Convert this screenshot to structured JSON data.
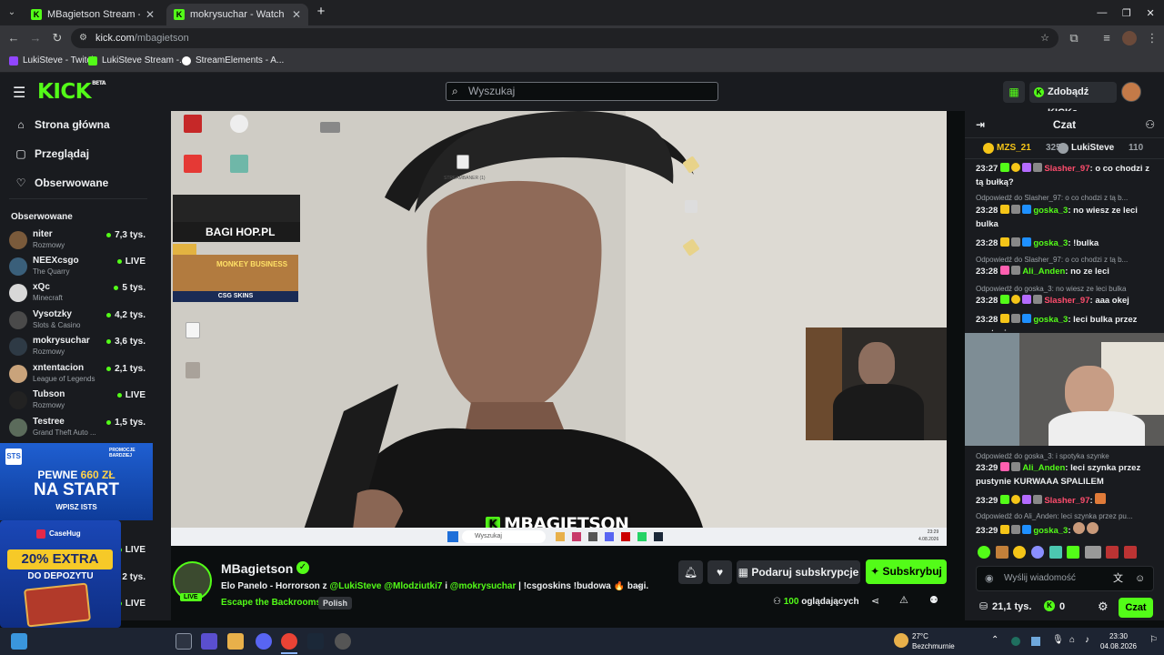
{
  "browser": {
    "tabs": [
      {
        "title": "MBagietson Stream - Watch Liv",
        "active": false
      },
      {
        "title": "mokrysuchar - Watch clips on K",
        "active": true
      }
    ],
    "new_tab": "+",
    "url_host": "kick.com",
    "url_path": "/mbagietson",
    "bookmarks": [
      {
        "label": "LukiSteve - Twitch",
        "color": "#9146ff"
      },
      {
        "label": "LukiSteve Stream -...",
        "color": "#53fc18"
      },
      {
        "label": "StreamElements - A...",
        "color": "#ffffff"
      }
    ]
  },
  "kick": {
    "logo": "KICK",
    "logo_beta": "BETA",
    "search_placeholder": "Wyszukaj",
    "get_kicks": "Zdobądź KICKs"
  },
  "sidebar": {
    "nav": [
      {
        "label": "Strona główna",
        "icon": "home-icon"
      },
      {
        "label": "Przeglądaj",
        "icon": "browse-icon"
      },
      {
        "label": "Obserwowane",
        "icon": "heart-icon"
      }
    ],
    "following_heading": "Obserwowane",
    "channels": [
      {
        "name": "niter",
        "category": "Rozmowy",
        "viewers": "7,3 tys.",
        "color": "#7a5a3b"
      },
      {
        "name": "NEEXcsgo",
        "category": "The Quarry",
        "viewers": "LIVE",
        "color": "#3a5f7a"
      },
      {
        "name": "xQc",
        "category": "Minecraft",
        "viewers": "5 tys.",
        "color": "#d8d8d8"
      },
      {
        "name": "Vysotzky",
        "category": "Slots & Casino",
        "viewers": "4,2 tys.",
        "color": "#4a4a4a"
      },
      {
        "name": "mokrysuchar",
        "category": "Rozmowy",
        "viewers": "3,6 tys.",
        "color": "#2e3a45"
      },
      {
        "name": "xntentacion",
        "category": "League of Legends",
        "viewers": "2,1 tys.",
        "color": "#c9a37b"
      },
      {
        "name": "Tubson",
        "category": "Rozmowy",
        "viewers": "LIVE",
        "color": "#222222"
      },
      {
        "name": "Testree",
        "category": "Grand Theft Auto ...",
        "viewers": "1,5 tys.",
        "color": "#5b6b5b"
      }
    ],
    "hidden_viewers": [
      "LIVE",
      "2 tys.",
      "LIVE"
    ],
    "ad1": {
      "promo": "PROMOCJE BARDZIEJ",
      "line1": "PEWNE",
      "amount": "660 ZŁ",
      "line2": "NA START",
      "code": "WPISZ ISTS"
    },
    "ad2": {
      "brand": "CaseHug",
      "headline": "20% EXTRA",
      "sub": "DO DEPOZYTU"
    }
  },
  "video": {
    "streamer_tag": "MBAGIETSON",
    "shop_label": "BAGI HOP.PL",
    "game_label": "MONKEY BUSINESS",
    "skins_label": "CSG SKINS",
    "desktop_label": "STREAMBANER (1)",
    "search": "Wyszukaj",
    "clock_time": "23:29",
    "clock_date": "4.08.2026"
  },
  "stream": {
    "name": "MBagietson",
    "live": "LIVE",
    "title_prefix": "Elo Panelo - Horrorson z ",
    "mention1": "@LukiSteve",
    "mention2": "@Mlodziutki7",
    "title_mid": " i ",
    "mention3": "@mokrysuchar",
    "title_suffix": " | !csgoskins !budowa 🔥 bagi...",
    "category": "Escape the Backrooms",
    "language": "Polish",
    "gift_label": "Podaruj subskrypcje",
    "subscribe_label": "Subskrybuj",
    "viewers_count": "100",
    "viewers_label": "oglądających"
  },
  "chat": {
    "title": "Czat",
    "leaderboard": [
      {
        "name": "MZS_21",
        "count": "325",
        "color": "#f5c518"
      },
      {
        "name": "LukiSteve",
        "count": "110",
        "color": "#eef0f2"
      }
    ],
    "messages": [
      {
        "time": "23:27",
        "user": "Slasher_97",
        "color": "#ff4d6d",
        "text": "o co chodzi z tą bułką?"
      },
      {
        "reply": "Odpowiedź do Slasher_97: o co chodzi z tą b..."
      },
      {
        "time": "23:28",
        "user": "goska_3",
        "color": "#53fc18",
        "text": "no wiesz ze leci bulka"
      },
      {
        "time": "23:28",
        "user": "goska_3",
        "color": "#53fc18",
        "text": "!bulka"
      },
      {
        "reply": "Odpowiedź do Slasher_97: o co chodzi z tą b..."
      },
      {
        "time": "23:28",
        "user": "Ali_Anden",
        "color": "#53fc18",
        "text": "no ze leci"
      },
      {
        "reply": "Odpowiedź do goska_3: no wiesz ze leci bulka"
      },
      {
        "time": "23:28",
        "user": "Slasher_97",
        "color": "#ff4d6d",
        "text": "aaa okej"
      },
      {
        "time": "23:28",
        "user": "goska_3",
        "color": "#53fc18",
        "text": "leci bulka przez pustynie"
      },
      {
        "reply": "Odpowiedź do goska_3: i spotyka szynke"
      },
      {
        "time": "23:29",
        "user": "Ali_Anden",
        "color": "#53fc18",
        "text": "leci szynka przez pustynie KURWAAA SPALILEM"
      },
      {
        "time": "23:29",
        "user": "Slasher_97",
        "color": "#ff4d6d",
        "text": ""
      },
      {
        "reply": "Odpowiedź do Ali_Anden: leci szynka przez pu..."
      },
      {
        "time": "23:29",
        "user": "goska_3",
        "color": "#53fc18",
        "text": ""
      }
    ],
    "input_placeholder": "Wyślij wiadomość",
    "points": "21,1 tys.",
    "kicks": "0",
    "send_label": "Czat"
  },
  "windows": {
    "weather_temp": "27°C",
    "weather_desc": "Bezchmurnie",
    "time": "23:30",
    "date": "04.08.2026"
  }
}
